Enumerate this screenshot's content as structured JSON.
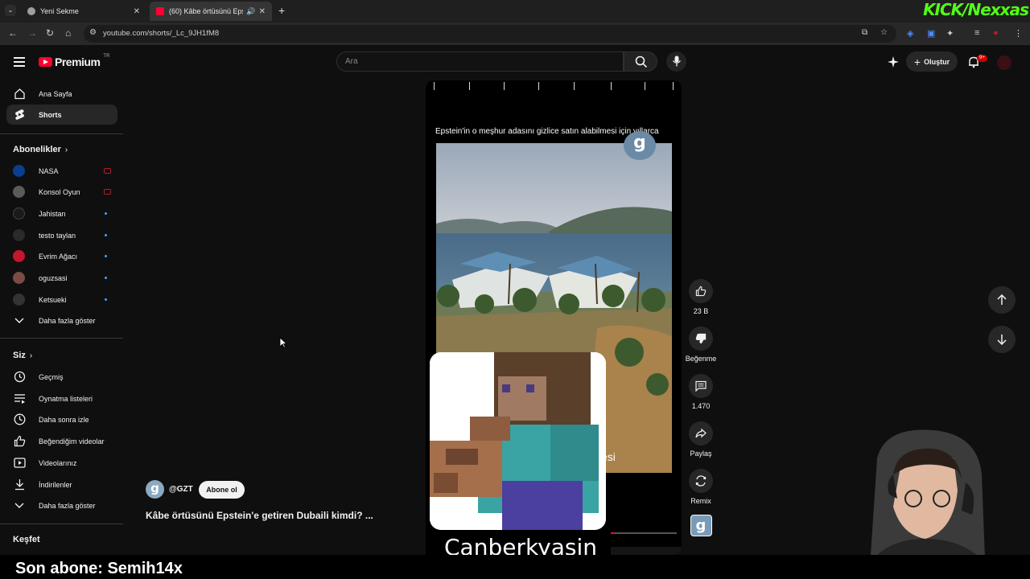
{
  "browser": {
    "tabs": [
      {
        "title": "Yeni Sekme",
        "active": false
      },
      {
        "title": "(60) Kâbe örtüsünü Epstein'e...",
        "active": true
      }
    ],
    "url": "youtube.com/shorts/_Lc_9JH1fM8",
    "overlay_logo": "KICK/Nexxas"
  },
  "header": {
    "logo_text": "Premium",
    "logo_region": "TR",
    "search_placeholder": "Ara",
    "create_label": "Oluştur",
    "notifications_badge": "9+"
  },
  "sidebar": {
    "main": [
      {
        "label": "Ana Sayfa",
        "icon": "home-icon"
      },
      {
        "label": "Shorts",
        "icon": "shorts-icon",
        "active": true
      }
    ],
    "subscriptions_header": "Abonelikler",
    "subscriptions": [
      {
        "label": "NASA",
        "status": "live",
        "color": "#0b3d91"
      },
      {
        "label": "Konsol Oyun",
        "status": "live",
        "color": "#5b5b5b"
      },
      {
        "label": "Jahistan",
        "status": "new",
        "color": "#1a1a1a"
      },
      {
        "label": "testo taylan",
        "status": "new",
        "color": "#2a2a2a"
      },
      {
        "label": "Evrim Ağacı",
        "status": "new",
        "color": "#c4162e"
      },
      {
        "label": "oguzsasi",
        "status": "new",
        "color": "#7a4c44"
      },
      {
        "label": "Ketsueki",
        "status": "new",
        "color": "#333"
      }
    ],
    "show_more_subs": "Daha fazla göster",
    "you_header": "Siz",
    "you_items": [
      {
        "label": "Geçmiş",
        "icon": "history-icon"
      },
      {
        "label": "Oynatma listeleri",
        "icon": "playlist-icon"
      },
      {
        "label": "Daha sonra izle",
        "icon": "clock-icon"
      },
      {
        "label": "Beğendiğim videolar",
        "icon": "thumbs-up-icon"
      },
      {
        "label": "Videolarınız",
        "icon": "video-icon"
      },
      {
        "label": "İndirilenler",
        "icon": "download-icon"
      }
    ],
    "show_more_you": "Daha fazla göster",
    "explore_header": "Keşfet"
  },
  "short": {
    "caption": "Epstein'in o meşhur adasını gizlice satın alabilmesi için yıllarca",
    "overlay_text": "esi",
    "channel_handle": "@GZT",
    "subscribe_label": "Abone ol",
    "title": "Kâbe örtüsünü Epstein'e getiren Dubaili kimdi? ...",
    "progress": 0.75
  },
  "actions": {
    "likes": "23 B",
    "dislike_label": "Beğenme",
    "comments": "1.470",
    "share_label": "Paylaş",
    "remix_label": "Remix"
  },
  "stream": {
    "last_subscriber": "Son abone: Semih14x",
    "creator_name": "Canberkyasin"
  }
}
